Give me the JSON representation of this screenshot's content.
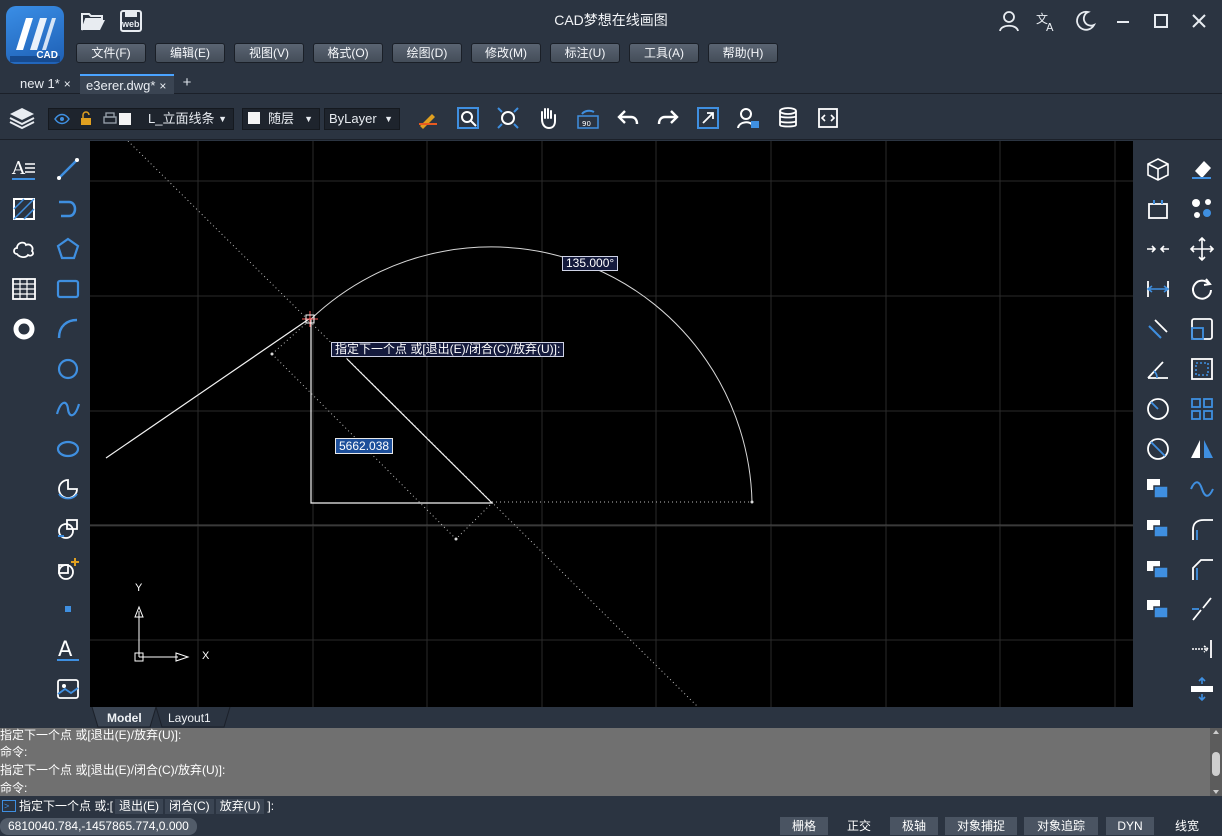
{
  "app": {
    "title": "CAD梦想在线画图",
    "logo_text": "CAD",
    "web_badge": "web"
  },
  "menu": [
    {
      "label": "文件(F)"
    },
    {
      "label": "编辑(E)"
    },
    {
      "label": "视图(V)"
    },
    {
      "label": "格式(O)"
    },
    {
      "label": "绘图(D)"
    },
    {
      "label": "修改(M)"
    },
    {
      "label": "标注(U)"
    },
    {
      "label": "工具(A)"
    },
    {
      "label": "帮助(H)"
    }
  ],
  "tabs": [
    {
      "label": "new 1*",
      "close": "×"
    },
    {
      "label": "e3erer.dwg*",
      "close": "×"
    }
  ],
  "tab_add": "+",
  "properties": {
    "layer": "L_立面线条",
    "color": "随层",
    "linetype": "ByLayer"
  },
  "canvas": {
    "background": "#000000",
    "angle_label": "135.000°",
    "prompt_tooltip": "指定下一个点 或[退出(E)/闭合(C)/放弃(U)]:",
    "length_input": "5662.038",
    "ucs_x": "X",
    "ucs_y": "Y"
  },
  "layout_tabs": [
    {
      "label": "Model"
    },
    {
      "label": "Layout1"
    }
  ],
  "command": {
    "history": [
      "指定下一个点 或[退出(E)/放弃(U)]:",
      "命令:",
      "指定下一个点 或[退出(E)/闭合(C)/放弃(U)]:",
      "命令:"
    ],
    "prompt_prefix": "指定下一个点 或:[",
    "options": [
      "退出(E)",
      "闭合(C)",
      "放弃(U)"
    ],
    "prompt_suffix": "]:"
  },
  "status": {
    "coordinates": "6810040.784,-1457865.774,0.000",
    "buttons": [
      {
        "label": "栅格",
        "active": true
      },
      {
        "label": "正交",
        "active": false
      },
      {
        "label": "极轴",
        "active": true
      },
      {
        "label": "对象捕捉",
        "active": true
      },
      {
        "label": "对象追踪",
        "active": true
      },
      {
        "label": "DYN",
        "active": true
      },
      {
        "label": "线宽",
        "active": false
      }
    ]
  },
  "icons": {
    "quick_access": [
      "folder-open-icon",
      "web-save-icon"
    ],
    "window": [
      "user-icon",
      "translate-icon",
      "theme-moon-icon",
      "minimize-icon",
      "maximize-icon",
      "close-icon"
    ],
    "toolbar": [
      "layers-icon",
      "visibility-eye-icon",
      "lock-icon",
      "print-icon",
      "match-properties-icon",
      "zoom-window-icon",
      "zoom-extents-icon",
      "pan-hand-icon",
      "rotate-view-icon",
      "undo-icon",
      "redo-icon",
      "zoom-fit-icon",
      "user-settings-icon",
      "database-icon",
      "code-icon"
    ],
    "left": [
      "multiline-text-icon",
      "line-icon",
      "hatch-icon",
      "polyline-icon",
      "revision-cloud-icon",
      "polygon-icon",
      "table-icon",
      "rectangle-icon",
      "donut-icon",
      "arc-icon",
      "circle-icon",
      "spline-icon",
      "ellipse-icon",
      "ellipse-arc-icon",
      "insert-block-icon",
      "create-block-icon",
      "point-icon",
      "text-icon",
      "image-icon"
    ],
    "right": [
      "3d-box-icon",
      "erase-icon",
      "copy-icon",
      "move-objects-icon",
      "join-icon",
      "move-icon",
      "dimension-linear-icon",
      "rotate-icon",
      "dimension-aligned-icon",
      "scale-icon",
      "dimension-angular-icon",
      "offset-icon",
      "dimension-radius-icon",
      "array-icon",
      "dimension-diameter-icon",
      "mirror-icon",
      "draw-order-front-icon",
      "wave-icon",
      "draw-order-back-icon",
      "fillet-icon",
      "bring-above-icon",
      "chamfer-icon",
      "send-under-icon",
      "break-icon",
      "extend-icon",
      "stretch-icon"
    ]
  }
}
